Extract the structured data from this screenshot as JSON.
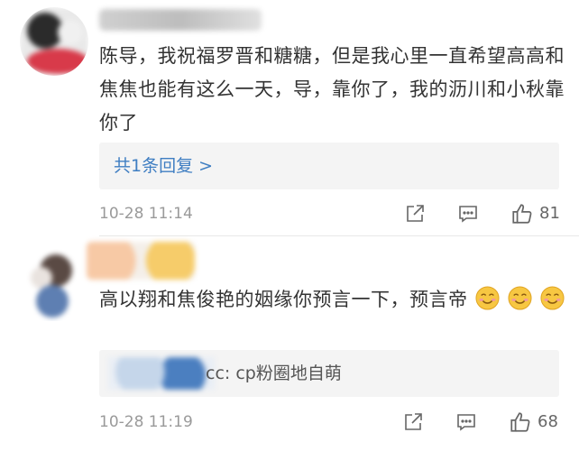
{
  "comments": [
    {
      "text": "陈导，我祝福罗晋和糖糖，但是我心里一直希望高高和焦焦也能有这么一天，导，靠你了，我的沥川和小秋靠你了",
      "reply_link": "共1条回复 >",
      "timestamp": "10-28 11:14",
      "likes": "81",
      "icons": {
        "share": "share-icon",
        "comment": "comment-icon",
        "like": "thumbs-up-icon"
      }
    },
    {
      "text": "高以翔和焦俊艳的姻缘你预言一下，预言帝",
      "emoji": "smile-emoji",
      "reply_preview": "cc: cp粉圈地自萌",
      "timestamp": "10-28 11:19",
      "likes": "68",
      "icons": {
        "share": "share-icon",
        "comment": "comment-icon",
        "like": "thumbs-up-icon"
      }
    }
  ],
  "colors": {
    "link": "#3f7ec2",
    "meta": "#9a9a9a",
    "reply_bg": "#f4f4f4"
  }
}
